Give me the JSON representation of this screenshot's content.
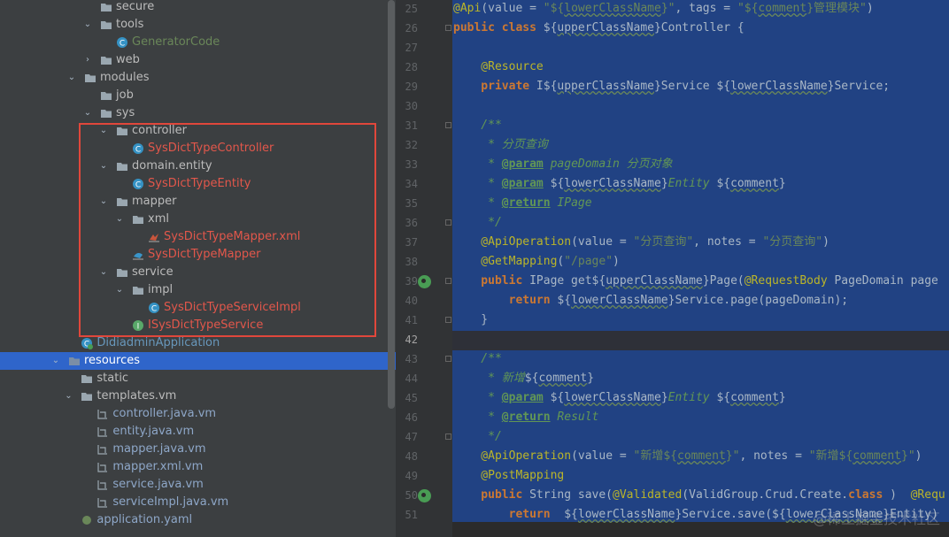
{
  "tree": {
    "rows": [
      {
        "name": "secure",
        "type": "folder",
        "indent": 1,
        "expand": ""
      },
      {
        "name": "tools",
        "type": "folder",
        "indent": 1,
        "expand": "open"
      },
      {
        "name": "GeneratorCode",
        "type": "class",
        "indent": 2,
        "expand": "",
        "color": "green"
      },
      {
        "name": "web",
        "type": "folder",
        "indent": 1,
        "expand": "closed"
      },
      {
        "name": "modules",
        "type": "folder",
        "indent": 0,
        "expand": "open"
      },
      {
        "name": "job",
        "type": "folder",
        "indent": 1,
        "expand": ""
      },
      {
        "name": "sys",
        "type": "folder",
        "indent": 1,
        "expand": "open"
      },
      {
        "name": "controller",
        "type": "folder",
        "indent": 2,
        "expand": "open"
      },
      {
        "name": "SysDictTypeController",
        "type": "class",
        "indent": 3,
        "expand": "",
        "color": "red"
      },
      {
        "name": "domain.entity",
        "type": "folder",
        "indent": 2,
        "expand": "open"
      },
      {
        "name": "SysDictTypeEntity",
        "type": "class",
        "indent": 3,
        "expand": "",
        "color": "red"
      },
      {
        "name": "mapper",
        "type": "folder",
        "indent": 2,
        "expand": "open"
      },
      {
        "name": "xml",
        "type": "folder",
        "indent": 3,
        "expand": "open"
      },
      {
        "name": "SysDictTypeMapper.xml",
        "type": "xml",
        "indent": 4,
        "expand": "",
        "color": "red"
      },
      {
        "name": "SysDictTypeMapper",
        "type": "mapper",
        "indent": 3,
        "expand": "",
        "color": "red"
      },
      {
        "name": "service",
        "type": "folder",
        "indent": 2,
        "expand": "open"
      },
      {
        "name": "impl",
        "type": "folder",
        "indent": 3,
        "expand": "open"
      },
      {
        "name": "SysDictTypeServiceImpl",
        "type": "class",
        "indent": 4,
        "expand": "",
        "color": "red"
      },
      {
        "name": "ISysDictTypeService",
        "type": "interface",
        "indent": 3,
        "expand": "",
        "color": "red"
      },
      {
        "name": "DidiadminApplication",
        "type": "app",
        "indent": -0.2,
        "expand": "",
        "color": "blue"
      },
      {
        "name": "resources",
        "type": "resfolder",
        "indent": -1,
        "expand": "open",
        "selected": true
      },
      {
        "name": "static",
        "type": "folder",
        "indent": -0.2,
        "expand": ""
      },
      {
        "name": "templates.vm",
        "type": "folder",
        "indent": -0.2,
        "expand": "open"
      },
      {
        "name": "controller.java.vm",
        "type": "vm",
        "indent": 0.8,
        "expand": "",
        "color": "file"
      },
      {
        "name": "entity.java.vm",
        "type": "vm",
        "indent": 0.8,
        "expand": "",
        "color": "file"
      },
      {
        "name": "mapper.java.vm",
        "type": "vm",
        "indent": 0.8,
        "expand": "",
        "color": "file"
      },
      {
        "name": "mapper.xml.vm",
        "type": "vm",
        "indent": 0.8,
        "expand": "",
        "color": "file"
      },
      {
        "name": "service.java.vm",
        "type": "vm",
        "indent": 0.8,
        "expand": "",
        "color": "file"
      },
      {
        "name": "serviceImpl.java.vm",
        "type": "vm",
        "indent": 0.8,
        "expand": "",
        "color": "file"
      },
      {
        "name": "application.yaml",
        "type": "yaml",
        "indent": -0.2,
        "expand": "",
        "color": "file"
      }
    ]
  },
  "editor": {
    "active_line": 42,
    "lines": [
      {
        "num": 25,
        "tokens": [
          [
            "a",
            "@Api"
          ],
          [
            "",
            "(value = "
          ],
          [
            "s",
            "\"${"
          ],
          [
            "su",
            "lowerClassName"
          ],
          [
            "s",
            "}\""
          ],
          [
            "",
            ", tags = "
          ],
          [
            "s",
            "\"${"
          ],
          [
            "su",
            "comment"
          ],
          [
            "s",
            "}管理模块\""
          ],
          [
            "",
            ")"
          ]
        ]
      },
      {
        "num": 26,
        "tokens": [
          [
            "k",
            "public class "
          ],
          [
            "",
            "${"
          ],
          [
            "u",
            "upperClassName"
          ],
          [
            "",
            "}Controller {"
          ]
        ]
      },
      {
        "num": 27,
        "tokens": []
      },
      {
        "num": 28,
        "tokens": [
          [
            "a",
            "    @Resource"
          ]
        ]
      },
      {
        "num": 29,
        "tokens": [
          [
            "k",
            "    private "
          ],
          [
            "",
            "I${"
          ],
          [
            "u",
            "upperClassName"
          ],
          [
            "",
            "}Service ${"
          ],
          [
            "u",
            "lowerClassName"
          ],
          [
            "",
            "}Service;"
          ]
        ]
      },
      {
        "num": 30,
        "tokens": []
      },
      {
        "num": 31,
        "tokens": [
          [
            "cm",
            "    /**"
          ]
        ]
      },
      {
        "num": 32,
        "tokens": [
          [
            "cm",
            "     * 分页查询"
          ]
        ]
      },
      {
        "num": 33,
        "tokens": [
          [
            "cm",
            "     * "
          ],
          [
            "tag",
            "@param"
          ],
          [
            "cm",
            " pageDomain 分页对象"
          ]
        ]
      },
      {
        "num": 34,
        "tokens": [
          [
            "cm",
            "     * "
          ],
          [
            "tag",
            "@param"
          ],
          [
            "",
            " ${"
          ],
          [
            "u",
            "lowerClassName"
          ],
          [
            "",
            "}"
          ],
          [
            "cm",
            "Entity"
          ],
          [
            "",
            " ${"
          ],
          [
            "u",
            "comment"
          ],
          [
            "",
            "}"
          ]
        ]
      },
      {
        "num": 35,
        "tokens": [
          [
            "cm",
            "     * "
          ],
          [
            "tag",
            "@return"
          ],
          [
            "cm",
            " IPage"
          ]
        ]
      },
      {
        "num": 36,
        "tokens": [
          [
            "cm",
            "     */"
          ]
        ]
      },
      {
        "num": 37,
        "tokens": [
          [
            "a",
            "    @ApiOperation"
          ],
          [
            "",
            "(value = "
          ],
          [
            "s",
            "\"分页查询\""
          ],
          [
            "",
            ", notes = "
          ],
          [
            "s",
            "\"分页查询\""
          ],
          [
            "",
            ")"
          ]
        ]
      },
      {
        "num": 38,
        "tokens": [
          [
            "a",
            "    @GetMapping"
          ],
          [
            "",
            "("
          ],
          [
            "s",
            "\"/page\""
          ],
          [
            "",
            ")"
          ]
        ]
      },
      {
        "num": 39,
        "tokens": [
          [
            "k",
            "    public "
          ],
          [
            "",
            "IPage get${"
          ],
          [
            "u",
            "upperClassName"
          ],
          [
            "",
            "}Page("
          ],
          [
            "a",
            "@RequestBody "
          ],
          [
            "",
            "PageDomain page"
          ]
        ]
      },
      {
        "num": 40,
        "tokens": [
          [
            "k",
            "        return "
          ],
          [
            "",
            "${"
          ],
          [
            "u",
            "lowerClassName"
          ],
          [
            "",
            "}Service.page(pageDomain);"
          ]
        ]
      },
      {
        "num": 41,
        "tokens": [
          [
            "",
            "    }"
          ]
        ]
      },
      {
        "num": 42,
        "tokens": []
      },
      {
        "num": 43,
        "tokens": [
          [
            "cm",
            "    /**"
          ]
        ]
      },
      {
        "num": 44,
        "tokens": [
          [
            "cm",
            "     * 新增"
          ],
          [
            "",
            "${"
          ],
          [
            "u",
            "comment"
          ],
          [
            "",
            "}"
          ]
        ]
      },
      {
        "num": 45,
        "tokens": [
          [
            "cm",
            "     * "
          ],
          [
            "tag",
            "@param"
          ],
          [
            "",
            " ${"
          ],
          [
            "u",
            "lowerClassName"
          ],
          [
            "",
            "}"
          ],
          [
            "cm",
            "Entity"
          ],
          [
            "",
            " ${"
          ],
          [
            "u",
            "comment"
          ],
          [
            "",
            "}"
          ]
        ]
      },
      {
        "num": 46,
        "tokens": [
          [
            "cm",
            "     * "
          ],
          [
            "tag",
            "@return"
          ],
          [
            "cm",
            " Result"
          ]
        ]
      },
      {
        "num": 47,
        "tokens": [
          [
            "cm",
            "     */"
          ]
        ]
      },
      {
        "num": 48,
        "tokens": [
          [
            "a",
            "    @ApiOperation"
          ],
          [
            "",
            "(value = "
          ],
          [
            "s",
            "\"新增${"
          ],
          [
            "su",
            "comment"
          ],
          [
            "s",
            "}\""
          ],
          [
            "",
            ", notes = "
          ],
          [
            "s",
            "\"新增${"
          ],
          [
            "su",
            "comment"
          ],
          [
            "s",
            "}\""
          ],
          [
            "",
            ")"
          ]
        ]
      },
      {
        "num": 49,
        "tokens": [
          [
            "a",
            "    @PostMapping"
          ]
        ]
      },
      {
        "num": 50,
        "tokens": [
          [
            "k",
            "    public "
          ],
          [
            "",
            "String save("
          ],
          [
            "a",
            "@Validated"
          ],
          [
            "",
            "(ValidGroup.Crud.Create."
          ],
          [
            "k",
            "class"
          ],
          [
            "",
            " )  "
          ],
          [
            "a",
            "@Requ"
          ]
        ]
      },
      {
        "num": 51,
        "tokens": [
          [
            "k",
            "        return  "
          ],
          [
            "",
            "${"
          ],
          [
            "u",
            "lowerClassName"
          ],
          [
            "",
            "}Service.save(${"
          ],
          [
            "u",
            "lowerClassName"
          ],
          [
            "",
            "}Entity)"
          ]
        ]
      }
    ]
  },
  "watermark": "@稀土掘金技术社区"
}
